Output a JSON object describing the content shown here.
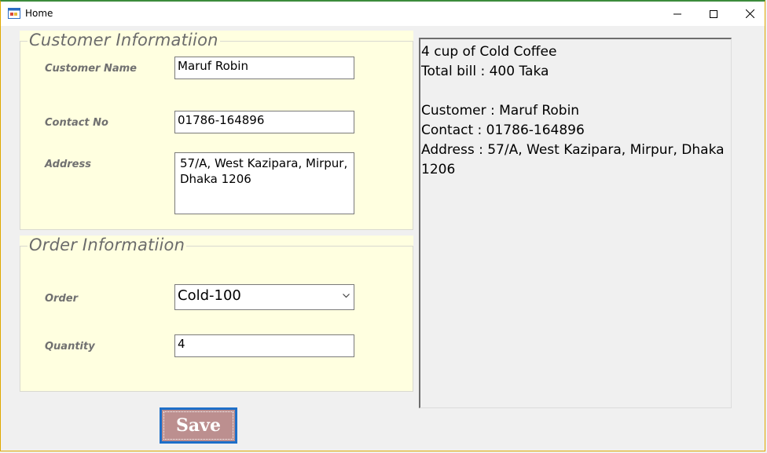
{
  "window": {
    "title": "Home",
    "icon": "winforms-app-icon"
  },
  "customer_group": {
    "title": "Customer Informatiion",
    "name_label": "Customer Name",
    "name_value": "Maruf Robin",
    "contact_label": "Contact No",
    "contact_value": "01786-164896",
    "address_label": "Address",
    "address_value": "57/A, West Kazipara, Mirpur, Dhaka 1206"
  },
  "order_group": {
    "title": "Order Informatiion",
    "order_label": "Order",
    "order_value": "Cold-100",
    "quantity_label": "Quantity",
    "quantity_value": "4"
  },
  "output": {
    "line1": "4 cup of Cold Coffee",
    "line2": "Total bill : 400 Taka",
    "line3": "Customer : Maruf Robin",
    "line4": "Contact : 01786-164896",
    "line5": "Address : 57/A, West Kazipara, Mirpur, Dhaka 1206"
  },
  "save_button": {
    "label": "Save"
  },
  "colors": {
    "group_background": "#ffffe0",
    "save_button": "#bc8f8f",
    "focus_border": "#1e6fc8"
  }
}
